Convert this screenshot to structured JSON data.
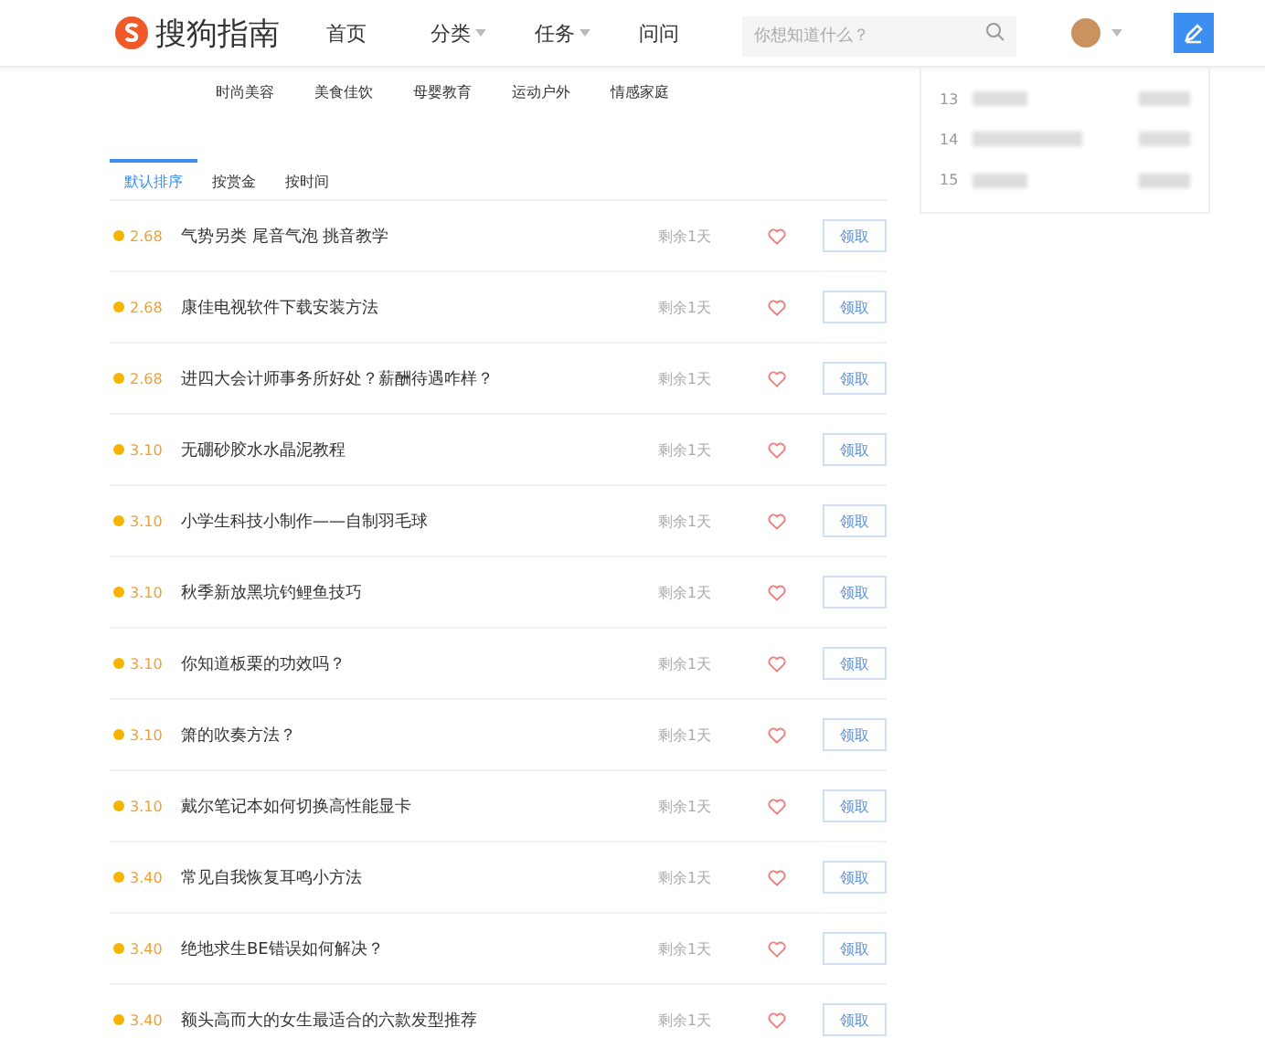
{
  "header": {
    "logo": "搜狗指南",
    "nav": [
      {
        "label": "首页",
        "dropdown": false
      },
      {
        "label": "分类",
        "dropdown": true
      },
      {
        "label": "任务",
        "dropdown": true
      },
      {
        "label": "问问",
        "dropdown": false
      }
    ],
    "search": {
      "placeholder": "你想知道什么？"
    }
  },
  "categories": [
    "时尚美容",
    "美食佳饮",
    "母婴教育",
    "运动户外",
    "情感家庭"
  ],
  "tabs": [
    {
      "label": "默认排序",
      "selected": true
    },
    {
      "label": "按赏金",
      "selected": false
    },
    {
      "label": "按时间",
      "selected": false
    }
  ],
  "tasks": [
    {
      "reward": "2.68",
      "title": "气势另类 尾音气泡 挑音教学",
      "remaining": "剩余1天",
      "action": "领取"
    },
    {
      "reward": "2.68",
      "title": "康佳电视软件下载安装方法",
      "remaining": "剩余1天",
      "action": "领取"
    },
    {
      "reward": "2.68",
      "title": "进四大会计师事务所好处？薪酬待遇咋样？",
      "remaining": "剩余1天",
      "action": "领取"
    },
    {
      "reward": "3.10",
      "title": "无硼砂胶水水晶泥教程",
      "remaining": "剩余1天",
      "action": "领取"
    },
    {
      "reward": "3.10",
      "title": "小学生科技小制作——自制羽毛球",
      "remaining": "剩余1天",
      "action": "领取"
    },
    {
      "reward": "3.10",
      "title": "秋季新放黑坑钓鲤鱼技巧",
      "remaining": "剩余1天",
      "action": "领取"
    },
    {
      "reward": "3.10",
      "title": "你知道板栗的功效吗？",
      "remaining": "剩余1天",
      "action": "领取"
    },
    {
      "reward": "3.10",
      "title": "箫的吹奏方法？",
      "remaining": "剩余1天",
      "action": "领取"
    },
    {
      "reward": "3.10",
      "title": "戴尔笔记本如何切换高性能显卡",
      "remaining": "剩余1天",
      "action": "领取"
    },
    {
      "reward": "3.40",
      "title": "常见自我恢复耳鸣小方法",
      "remaining": "剩余1天",
      "action": "领取"
    },
    {
      "reward": "3.40",
      "title": "绝地求生BE错误如何解决？",
      "remaining": "剩余1天",
      "action": "领取"
    },
    {
      "reward": "3.40",
      "title": "额头高而大的女生最适合的六款发型推荐",
      "remaining": "剩余1天",
      "action": "领取"
    }
  ],
  "ranking": [
    {
      "rank": "13"
    },
    {
      "rank": "14"
    },
    {
      "rank": "15"
    }
  ]
}
